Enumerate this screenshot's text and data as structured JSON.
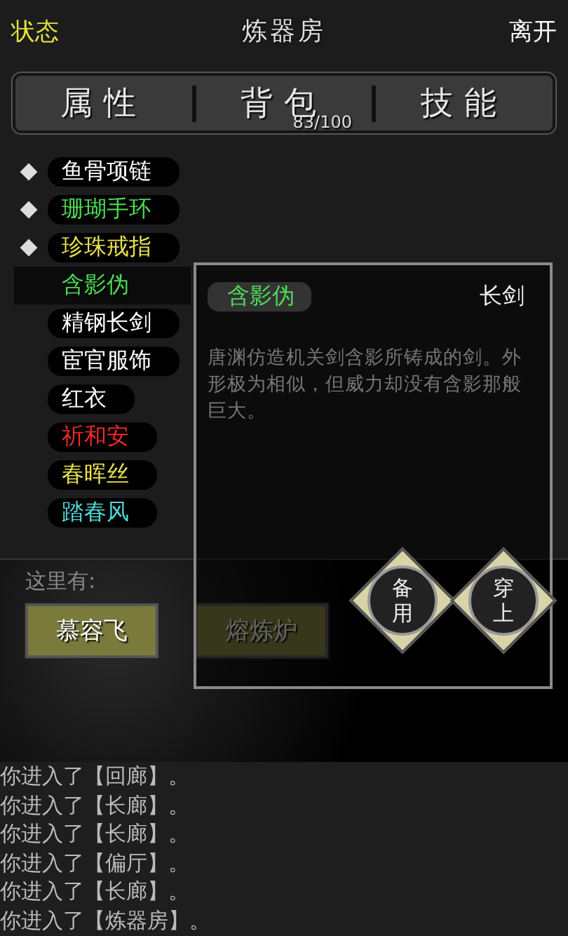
{
  "header": {
    "status_button": "状态",
    "title": "炼器房",
    "leave_button": "离开"
  },
  "tabs": [
    {
      "label": "属性"
    },
    {
      "label": "背包",
      "count": "83/100"
    },
    {
      "label": "技能"
    }
  ],
  "inventory": [
    {
      "name": "鱼骨项链",
      "color": "#ffffff",
      "equipped": true,
      "selected": false
    },
    {
      "name": "珊瑚手环",
      "color": "#4ddb55",
      "equipped": true,
      "selected": false
    },
    {
      "name": "珍珠戒指",
      "color": "#e8e04a",
      "equipped": true,
      "selected": false
    },
    {
      "name": "含影伪",
      "color": "#4ddb55",
      "equipped": false,
      "selected": true
    },
    {
      "name": "精钢长剑",
      "color": "#ffffff",
      "equipped": false,
      "selected": false
    },
    {
      "name": "宦官服饰",
      "color": "#ffffff",
      "equipped": false,
      "selected": false
    },
    {
      "name": "红衣",
      "color": "#ffffff",
      "equipped": false,
      "selected": false
    },
    {
      "name": "祈和安",
      "color": "#ee2a2a",
      "equipped": false,
      "selected": false
    },
    {
      "name": "春晖丝",
      "color": "#e8e04a",
      "equipped": false,
      "selected": false
    },
    {
      "name": "踏春风",
      "color": "#4fd8d8",
      "equipped": false,
      "selected": false
    }
  ],
  "detail": {
    "name": "含影伪",
    "type": "长剑",
    "description": "唐渊仿造机关剑含影所铸成的剑。外形极为相似，但威力却没有含影那般巨大。",
    "buttons": [
      "备用",
      "穿上"
    ]
  },
  "here": {
    "label": "这里有:",
    "items": [
      "慕容飞",
      "熔炼炉"
    ]
  },
  "log": [
    "你进入了【回廊】。",
    "你进入了【长廊】。",
    "你进入了【长廊】。",
    "你进入了【偏厅】。",
    "你进入了【长廊】。",
    "你进入了【炼器房】。"
  ]
}
